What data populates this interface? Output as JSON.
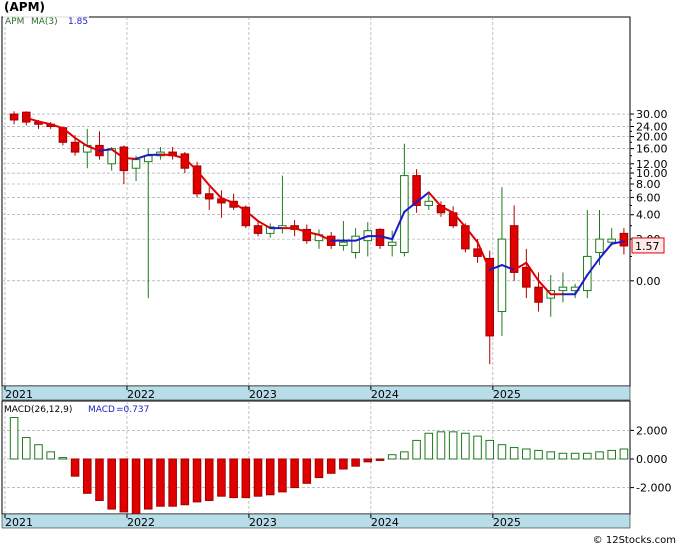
{
  "header": {
    "title": "(APM)"
  },
  "colors": {
    "up_edge": "#1f7a1f",
    "down_fill": "#e00000",
    "ma_up": "#1a1acc",
    "ma_down": "#e00000",
    "macd_pos": "#1f7a1f",
    "macd_neg": "#e00000",
    "axis_band": "#b8dde8",
    "grid": "#999999",
    "legend_label": "#2a6f2a",
    "legend_value": "#2222cc"
  },
  "chart_data": [
    {
      "type": "candlestick",
      "title": "(APM)",
      "legend": [
        {
          "label": "APM",
          "value": ""
        },
        {
          "label": "MA(3)",
          "value": "1.85"
        }
      ],
      "y_scale": "log (price + 2)",
      "y_ticks": [
        "30.00",
        "24.00",
        "20.00",
        "16.00",
        "12.00",
        "10.00",
        "8.00",
        "6.00",
        "4.00",
        "2.00",
        "0.00"
      ],
      "y_tick_values": [
        30,
        24,
        20,
        16,
        12,
        10,
        8,
        6,
        4,
        2,
        0
      ],
      "x_tick_labels": [
        "2021",
        "2022",
        "2023",
        "2024",
        "2025"
      ],
      "x_tick_index": [
        0,
        10,
        20,
        30,
        40
      ],
      "grid": true,
      "last_price": "1.57",
      "candles": [
        [
          30,
          31.5,
          25,
          27
        ],
        [
          31,
          31.5,
          24.5,
          26
        ],
        [
          26,
          27,
          23,
          25
        ],
        [
          25,
          26,
          23,
          24
        ],
        [
          23.5,
          24,
          17,
          18
        ],
        [
          18,
          20.5,
          14,
          15
        ],
        [
          15,
          23,
          11,
          17
        ],
        [
          17,
          22,
          13,
          14
        ],
        [
          12,
          16.5,
          10.5,
          16
        ],
        [
          16.5,
          17,
          8,
          10.5
        ],
        [
          11,
          14,
          8.5,
          13
        ],
        [
          12.5,
          16,
          -0.5,
          14
        ],
        [
          14,
          16.5,
          13,
          15
        ],
        [
          15,
          16.5,
          13,
          14
        ],
        [
          14.5,
          15,
          10,
          11
        ],
        [
          11.5,
          12.5,
          6,
          6.5
        ],
        [
          6.5,
          7.5,
          4.5,
          5.8
        ],
        [
          5.8,
          7,
          3.7,
          5.3
        ],
        [
          5.5,
          6.5,
          4.5,
          4.8
        ],
        [
          4.8,
          5,
          2.8,
          3
        ],
        [
          3,
          3.5,
          2.2,
          2.4
        ],
        [
          2.4,
          3.2,
          2.1,
          2.9
        ],
        [
          2.8,
          9.5,
          2.4,
          3
        ],
        [
          3,
          3.5,
          2.2,
          2.7
        ],
        [
          2.7,
          3.1,
          1.7,
          1.9
        ],
        [
          1.9,
          2.7,
          1.4,
          2.3
        ],
        [
          2.2,
          2.5,
          1.4,
          1.6
        ],
        [
          1.6,
          3.4,
          1.3,
          1.8
        ],
        [
          1.2,
          2.8,
          0.9,
          2.2
        ],
        [
          1.9,
          3.3,
          1,
          2.6
        ],
        [
          2.7,
          2.8,
          1.4,
          1.6
        ],
        [
          1.6,
          2.6,
          1,
          1.8
        ],
        [
          1.2,
          17.5,
          1,
          9.5
        ],
        [
          9.5,
          10.8,
          4.2,
          5
        ],
        [
          5,
          6.5,
          4.5,
          5.5
        ],
        [
          5,
          5.5,
          3.8,
          4.2
        ],
        [
          4.2,
          4.9,
          2.8,
          3
        ],
        [
          3,
          3.2,
          1.2,
          1.4
        ],
        [
          1.4,
          2,
          0.7,
          1
        ],
        [
          0.9,
          1.3,
          -1.5,
          -1.2
        ],
        [
          -0.8,
          7.5,
          -1.2,
          2
        ],
        [
          3,
          5,
          0,
          0.3
        ],
        [
          0.5,
          1.4,
          -0.5,
          -0.2
        ],
        [
          -0.2,
          0.3,
          -0.8,
          -0.6
        ],
        [
          -0.5,
          0.2,
          -0.9,
          -0.3
        ],
        [
          -0.3,
          0.3,
          -0.6,
          -0.2
        ],
        [
          -0.3,
          -0.1,
          -0.5,
          -0.2
        ],
        [
          -0.3,
          4.5,
          -0.5,
          1
        ],
        [
          1.2,
          4.5,
          0.6,
          2
        ],
        [
          1.8,
          2.8,
          1.6,
          2
        ],
        [
          2.4,
          2.8,
          1.1,
          1.57
        ]
      ],
      "ma3": [
        null,
        28,
        26.3,
        25,
        23.3,
        19.5,
        16.8,
        15.4,
        15.8,
        13.4,
        13.2,
        14.2,
        14.3,
        14.2,
        13.3,
        10.5,
        7.8,
        5.9,
        5.3,
        4.4,
        3.4,
        2.8,
        2.8,
        2.8,
        2.5,
        2.3,
        1.9,
        1.9,
        1.9,
        2.2,
        2.2,
        2,
        4.3,
        5.4,
        6.7,
        4.9,
        4.2,
        2.9,
        1.8,
        0.4,
        0.6,
        0.4,
        0.7,
        0,
        -0.4,
        -0.4,
        -0.4,
        0.2,
        0.9,
        1.7,
        1.85
      ],
      "ma3_segments_color": [
        "none",
        "down",
        "down",
        "down",
        "down",
        "down",
        "down",
        "down",
        "up",
        "down",
        "down",
        "up",
        "up",
        "down",
        "down",
        "down",
        "down",
        "down",
        "down",
        "down",
        "down",
        "down",
        "up",
        "down",
        "down",
        "down",
        "down",
        "up",
        "up",
        "up",
        "up",
        "up",
        "up",
        "up",
        "up",
        "down",
        "down",
        "down",
        "down",
        "down",
        "up",
        "up",
        "down",
        "down",
        "down",
        "down",
        "up",
        "up",
        "up",
        "up",
        "up"
      ]
    },
    {
      "type": "bar",
      "title": "MACD(26,12,9)",
      "legend": [
        {
          "label": "MACD(26,12,9)",
          "value": ""
        },
        {
          "label": "MACD",
          "value": "=0.737"
        }
      ],
      "y_ticks": [
        "2.000",
        "0.000",
        "-2.000"
      ],
      "y_tick_values": [
        2,
        0,
        -2
      ],
      "x_tick_labels": [
        "2021",
        "2022",
        "2023",
        "2024",
        "2025"
      ],
      "x_tick_index": [
        0,
        10,
        20,
        30,
        40
      ],
      "values": [
        2.9,
        1.5,
        1.0,
        0.5,
        0.1,
        -1.2,
        -2.4,
        -2.9,
        -3.5,
        -3.7,
        -3.9,
        -3.5,
        -3.3,
        -3.3,
        -3.2,
        -3.0,
        -2.9,
        -2.6,
        -2.7,
        -2.7,
        -2.6,
        -2.5,
        -2.3,
        -2.0,
        -1.7,
        -1.3,
        -1.0,
        -0.7,
        -0.5,
        -0.2,
        -0.1,
        0.3,
        0.5,
        1.3,
        1.8,
        1.9,
        1.9,
        1.8,
        1.6,
        1.3,
        1.0,
        0.8,
        0.7,
        0.6,
        0.5,
        0.4,
        0.4,
        0.4,
        0.5,
        0.6,
        0.7
      ]
    }
  ],
  "footer": {
    "credit": "© 12Stocks.com"
  }
}
